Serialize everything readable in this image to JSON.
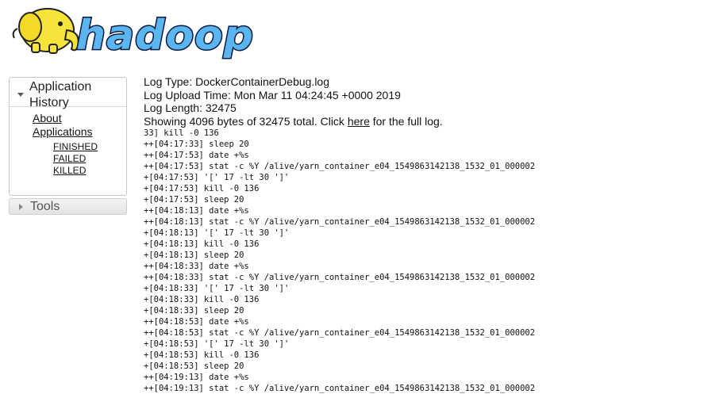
{
  "logo": {
    "text": "hadoop"
  },
  "sidebar": {
    "application_panel": {
      "title": "Application History",
      "links": [
        "About",
        "Applications"
      ],
      "sub_links": [
        "FINISHED",
        "FAILED",
        "KILLED"
      ]
    },
    "tools_label": "Tools"
  },
  "log": {
    "type_line": "Log Type: DockerContainerDebug.log",
    "upload_line": "Log Upload Time: Mon Mar 11 04:24:45 +0000 2019",
    "length_line": "Log Length: 32475",
    "showing_prefix": "Showing 4096 bytes of 32475 total. Click ",
    "here_link": "here",
    "showing_suffix": " for the full log.",
    "lines": [
      "33] kill -0 136",
      "++[04:17:33] sleep 20",
      "++[04:17:53] date +%s",
      "++[04:17:53] stat -c %Y /alive/yarn_container_e04_1549863142138_1532_01_000002",
      "+[04:17:53] '[' 17 -lt 30 ']'",
      "+[04:17:53] kill -0 136",
      "+[04:17:53] sleep 20",
      "++[04:18:13] date +%s",
      "++[04:18:13] stat -c %Y /alive/yarn_container_e04_1549863142138_1532_01_000002",
      "+[04:18:13] '[' 17 -lt 30 ']'",
      "+[04:18:13] kill -0 136",
      "+[04:18:13] sleep 20",
      "++[04:18:33] date +%s",
      "++[04:18:33] stat -c %Y /alive/yarn_container_e04_1549863142138_1532_01_000002",
      "+[04:18:33] '[' 17 -lt 30 ']'",
      "+[04:18:33] kill -0 136",
      "+[04:18:33] sleep 20",
      "++[04:18:53] date +%s",
      "++[04:18:53] stat -c %Y /alive/yarn_container_e04_1549863142138_1532_01_000002",
      "+[04:18:53] '[' 17 -lt 30 ']'",
      "+[04:18:53] kill -0 136",
      "+[04:18:53] sleep 20",
      "++[04:19:13] date +%s",
      "++[04:19:13] stat -c %Y /alive/yarn_container_e04_1549863142138_1532_01_000002"
    ]
  }
}
